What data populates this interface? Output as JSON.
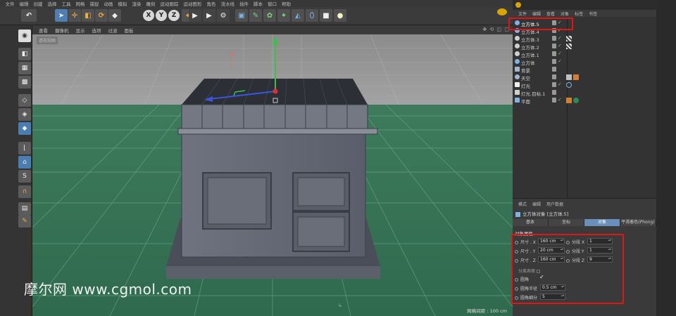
{
  "menubar": {
    "items": [
      "文件",
      "编辑",
      "创建",
      "选择",
      "工具",
      "网格",
      "捕捉",
      "动画",
      "模拟",
      "渲染",
      "雕刻",
      "运动跟踪",
      "运动图形",
      "角色",
      "流水线",
      "插件",
      "脚本",
      "窗口",
      "帮助"
    ]
  },
  "toolbar": {
    "xyz": [
      "X",
      "Y",
      "Z"
    ]
  },
  "viewport": {
    "menu": [
      "查看",
      "摄像机",
      "显示",
      "选项",
      "过滤",
      "面板"
    ],
    "label": "透视视图",
    "grid_footer": "网格间距 : 100 cm",
    "nav_icons": "✥ ⟲ ◫ ▢"
  },
  "watermark": "摩尔网 www.cgmol.com",
  "object_manager": {
    "menu": [
      "文件",
      "编辑",
      "查看",
      "对象",
      "标签",
      "书签"
    ],
    "rows": [
      {
        "name": "立方体.5",
        "selected": true
      },
      {
        "name": "立方体.4"
      },
      {
        "name": "立方体.3"
      },
      {
        "name": "立方体.2"
      },
      {
        "name": "立方体.1"
      },
      {
        "name": "立方体"
      },
      {
        "name": "背景"
      },
      {
        "name": "天空"
      },
      {
        "name": "灯光"
      },
      {
        "name": "灯光.目标.1"
      },
      {
        "name": "平面"
      }
    ]
  },
  "attributes": {
    "menu": [
      "模式",
      "编辑",
      "用户数据"
    ],
    "title": "立方体对象 [立方体.5]",
    "tabs": [
      "基本",
      "坐标",
      "对象",
      "平滑着色(Phong)"
    ],
    "active_tab": "对象",
    "section": "对象属性",
    "size_x_label": "尺寸 . X",
    "size_x": "160 cm",
    "size_y_label": "尺寸 . Y",
    "size_y": "20 cm",
    "size_z_label": "尺寸 . Z",
    "size_z": "160 cm",
    "seg_x_label": "分段 X",
    "seg_x": "1",
    "seg_y_label": "分段 Y",
    "seg_y": "1",
    "seg_z_label": "分段 Z",
    "seg_z": "9",
    "separate_label": "分离表面",
    "fillet_label": "圆角",
    "fillet_check": "✓",
    "fillet_radius_label": "圆角半径",
    "fillet_radius": "0.5 cm",
    "fillet_sub_label": "圆角细分",
    "fillet_sub": "5"
  },
  "colors": {
    "accent": "#4e7fb0",
    "highlight": "#e01515",
    "ground": "#3a7558"
  }
}
